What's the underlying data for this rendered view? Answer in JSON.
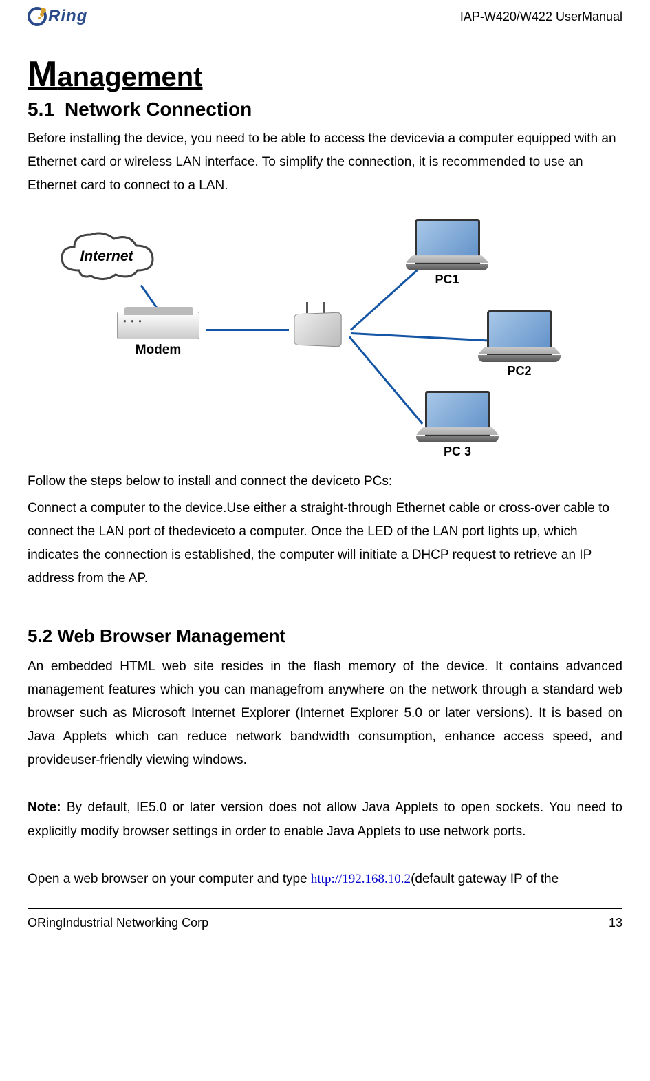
{
  "header": {
    "logo_text": "Ring",
    "doc_title": "IAP-W420/W422  UserManual"
  },
  "main": {
    "heading_big": "M",
    "heading_rest": "anagement",
    "section_5_1": {
      "num": "5.1",
      "title": "Network Connection",
      "para1": "Before installing the device, you need to be able to access the devicevia a computer equipped with an Ethernet card or wireless LAN interface. To simplify the connection, it is recommended to use an Ethernet card to connect to a LAN.",
      "para2": "Follow the steps below to install and connect the deviceto PCs:",
      "para3": "Connect a computer to the device.Use either a straight-through Ethernet cable or cross-over cable to connect the LAN port of thedeviceto a computer. Once the LED of the LAN port lights up, which indicates the connection is established, the computer will initiate a DHCP request to retrieve an IP address from the AP."
    },
    "diagram": {
      "internet": "Internet",
      "modem": "Modem",
      "pc1": "PC1",
      "pc2": "PC2",
      "pc3": "PC 3"
    },
    "section_5_2": {
      "title": "5.2 Web Browser Management",
      "para1": "An embedded HTML web site resides in the flash memory of the device. It contains advanced management features which you can managefrom anywhere on the network through a standard web browser such as Microsoft Internet Explorer (Internet Explorer 5.0 or later versions). It is based on Java Applets which can reduce network bandwidth consumption, enhance access speed, and provideuser-friendly viewing windows.",
      "note_label": "Note:",
      "note_text": " By default, IE5.0 or later version does not allow Java Applets to open sockets. You need to explicitly modify browser settings in order to enable Java Applets to use network ports.",
      "para3_pre": "Open a web browser on your computer and type ",
      "link": "http://192.168.10.2",
      "para3_post": "(default gateway IP of the"
    }
  },
  "footer": {
    "left": "ORingIndustrial Networking Corp",
    "page": "13"
  }
}
